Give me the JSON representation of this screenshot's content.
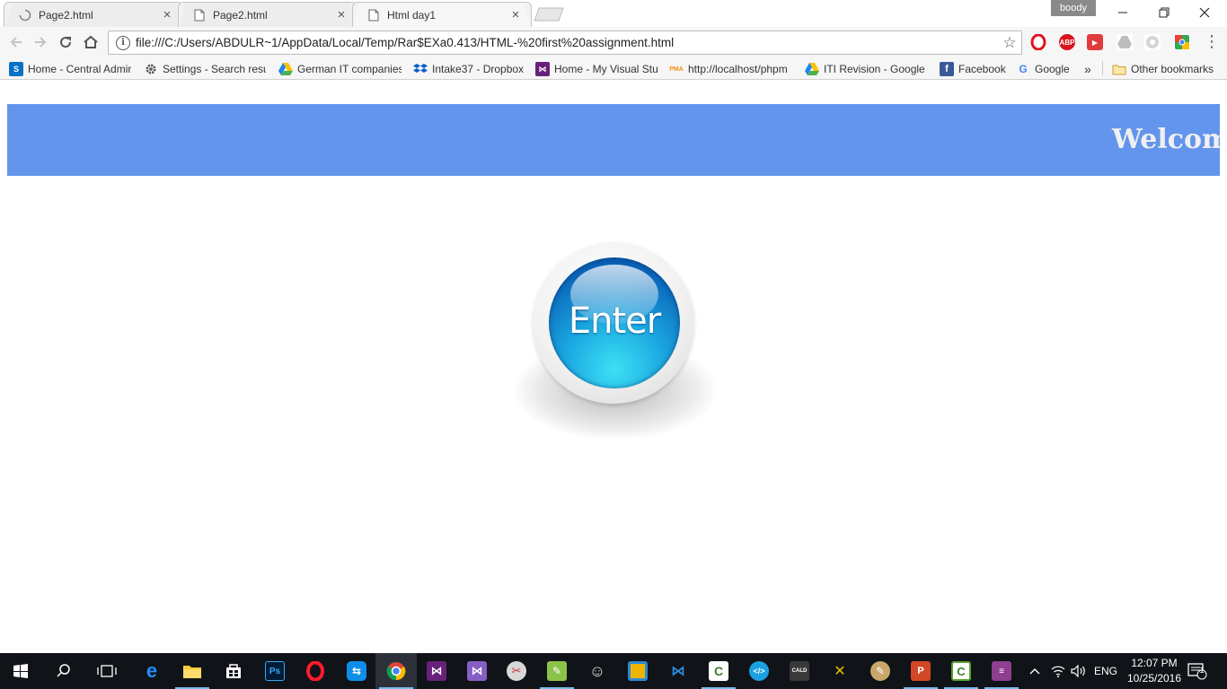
{
  "browser": {
    "tabs": [
      {
        "title": "Page2.html",
        "active": false,
        "loading": true
      },
      {
        "title": "Page2.html",
        "active": false,
        "loading": false
      },
      {
        "title": "Html day1",
        "active": true,
        "loading": false
      }
    ],
    "profile_name": "boody",
    "address_bar": {
      "url": "file:///C:/Users/ABDULR~1/AppData/Local/Temp/Rar$EXa0.413/HTML-%20first%20assignment.html"
    },
    "extensions": [
      "opera-icon",
      "adblock-plus-icon",
      "youtube-extension-icon",
      "drive-extension-icon",
      "ext-gray-icon",
      "chrome-extension-icon"
    ],
    "bookmarks": [
      {
        "label": "Home - Central Admin",
        "icon": "sharepoint-icon"
      },
      {
        "label": "Settings - Search resu",
        "icon": "gear-icon"
      },
      {
        "label": "German IT companies",
        "icon": "google-drive-icon"
      },
      {
        "label": "Intake37 - Dropbox",
        "icon": "dropbox-icon"
      },
      {
        "label": "Home - My Visual Stu",
        "icon": "visual-studio-icon"
      },
      {
        "label": "http://localhost/phpm",
        "icon": "phpmyadmin-icon"
      },
      {
        "label": "ITI Revision - Google",
        "icon": "google-drive-icon"
      },
      {
        "label": "Facebook",
        "icon": "facebook-icon"
      },
      {
        "label": "Google",
        "icon": "google-icon"
      }
    ],
    "overflow_label": "»",
    "other_bookmarks_label": "Other bookmarks"
  },
  "page": {
    "banner_text": "Welcome",
    "banner_color": "#6495ed",
    "enter_button_label": "Enter"
  },
  "taskbar": {
    "apps": [
      "windows-start-icon",
      "search-icon",
      "task-view-icon",
      "edge-icon",
      "file-explorer-icon",
      "store-icon",
      "photoshop-icon",
      "opera-icon",
      "teamviewer-icon",
      "chrome-icon",
      "visual-studio-icon",
      "visual-studio-icon-2",
      "snipping-icon",
      "notepad-plus-icon",
      "smiley-icon",
      "app-icon",
      "vscode-icon",
      "camtasia-icon",
      "brackets-icon",
      "calibre-icon",
      "tools-icon",
      "paint-icon",
      "powerpoint-icon",
      "camtasia-icon-2",
      "winrar-icon"
    ],
    "language": "ENG",
    "time": "12:07 PM",
    "date": "10/25/2016",
    "notification_count": "1"
  }
}
